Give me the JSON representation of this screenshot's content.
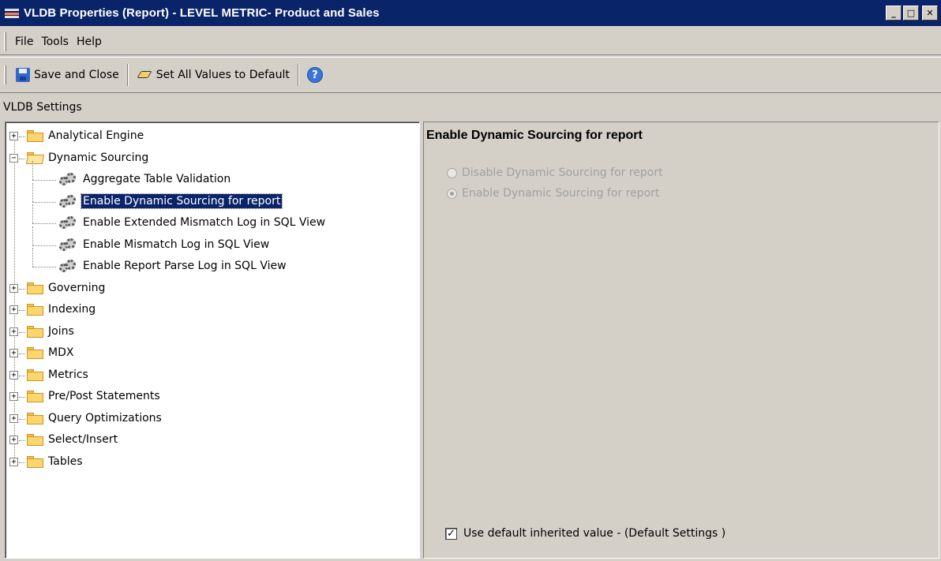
{
  "window": {
    "title": "VLDB Properties (Report) - LEVEL METRIC- Product and Sales",
    "minimize": "_",
    "maximize": "□",
    "close": "✕"
  },
  "menu": [
    "File",
    "Tools",
    "Help"
  ],
  "toolbar": {
    "save_close": "Save and Close",
    "set_default": "Set All Values to Default",
    "help": "?"
  },
  "section_label": "VLDB Settings",
  "tree": {
    "items": [
      {
        "label": "Analytical Engine",
        "type": "folder",
        "expander": "+"
      },
      {
        "label": "Dynamic Sourcing",
        "type": "folder-open",
        "expander": "−"
      },
      {
        "label": "Aggregate Table Validation",
        "type": "setting"
      },
      {
        "label": "Enable Dynamic Sourcing for report",
        "type": "setting",
        "selected": true
      },
      {
        "label": "Enable Extended Mismatch Log in SQL View",
        "type": "setting"
      },
      {
        "label": "Enable Mismatch Log in SQL View",
        "type": "setting"
      },
      {
        "label": "Enable Report Parse Log in SQL View",
        "type": "setting"
      },
      {
        "label": "Governing",
        "type": "folder",
        "expander": "+"
      },
      {
        "label": "Indexing",
        "type": "folder",
        "expander": "+"
      },
      {
        "label": "Joins",
        "type": "folder",
        "expander": "+"
      },
      {
        "label": "MDX",
        "type": "folder",
        "expander": "+"
      },
      {
        "label": "Metrics",
        "type": "folder",
        "expander": "+"
      },
      {
        "label": "Pre/Post Statements",
        "type": "folder",
        "expander": "+"
      },
      {
        "label": "Query Optimizations",
        "type": "folder",
        "expander": "+"
      },
      {
        "label": "Select/Insert",
        "type": "folder",
        "expander": "+"
      },
      {
        "label": "Tables",
        "type": "folder",
        "expander": "+"
      }
    ]
  },
  "detail": {
    "title": "Enable Dynamic Sourcing for report",
    "options": [
      {
        "label": "Disable Dynamic Sourcing for report",
        "checked": false
      },
      {
        "label": "Enable Dynamic Sourcing for report",
        "checked": true
      }
    ],
    "use_default": {
      "label": "Use default inherited value - (Default Settings )",
      "checked": true,
      "mark": "✓"
    }
  }
}
